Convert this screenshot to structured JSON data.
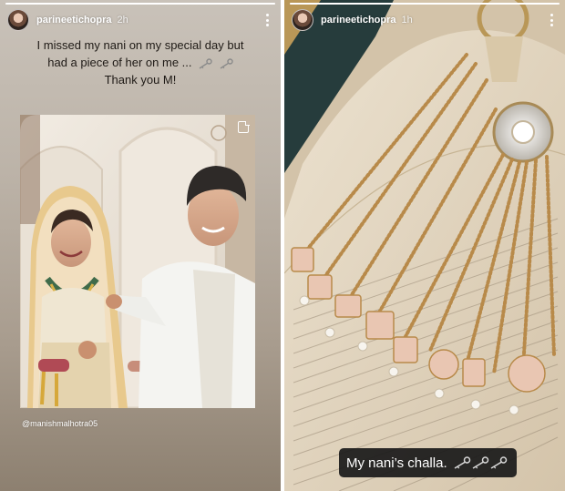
{
  "stories": [
    {
      "progress": 1.0,
      "user": {
        "username": "parineetichopra",
        "timestamp": "2h"
      },
      "caption": {
        "line1": "I missed my nani on my special day but",
        "line2": "had a piece of her on me ...",
        "line3": "Thank you M!",
        "emoji_icons": [
          "key-icon",
          "key-icon"
        ]
      },
      "mention": "@manishmalhotra05"
    },
    {
      "progress": 1.0,
      "user": {
        "username": "parineetichopra",
        "timestamp": "1h"
      },
      "sticker": {
        "text": "My nani’s challa.",
        "emoji_icons": [
          "key-icon",
          "key-icon",
          "key-icon"
        ]
      }
    }
  ],
  "colors": {
    "story_left_bg": "#bcb3a8",
    "sticker_bg": "#191919",
    "caption_text": "#1f1a16"
  }
}
